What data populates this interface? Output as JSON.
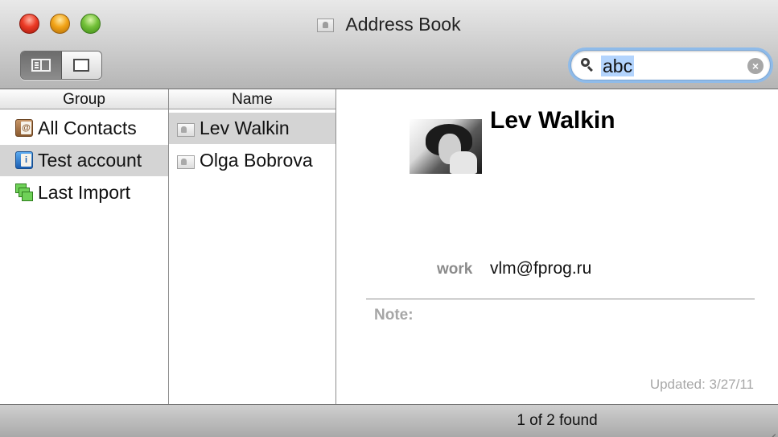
{
  "window": {
    "title": "Address Book"
  },
  "toolbar": {
    "view_buttons": [
      {
        "name": "card-and-list-view",
        "active": true
      },
      {
        "name": "card-only-view",
        "active": false
      }
    ],
    "search": {
      "value": "abc",
      "clear_icon": "clear-circle-icon",
      "search_icon": "magnifier-icon"
    }
  },
  "columns": {
    "group_header": "Group",
    "name_header": "Name"
  },
  "groups": [
    {
      "label": "All Contacts",
      "icon": "address-book-icon",
      "selected": false
    },
    {
      "label": "Test account",
      "icon": "address-book-icon",
      "selected": true
    },
    {
      "label": "Last Import",
      "icon": "smart-group-icon",
      "selected": false
    }
  ],
  "names": [
    {
      "label": "Lev Walkin",
      "icon": "contact-card-icon",
      "selected": true
    },
    {
      "label": "Olga Bobrova",
      "icon": "contact-card-icon",
      "selected": false
    }
  ],
  "card": {
    "name": "Lev Walkin",
    "email_label": "work",
    "email_value": "vlm@fprog.ru",
    "note_label": "Note:",
    "updated": "Updated: 3/27/11"
  },
  "status": {
    "text": "1 of 2 found"
  },
  "colors": {
    "selection_gray": "#d4d4d4",
    "search_focus": "#8fbbe9",
    "search_highlight": "#b3d4fd"
  }
}
